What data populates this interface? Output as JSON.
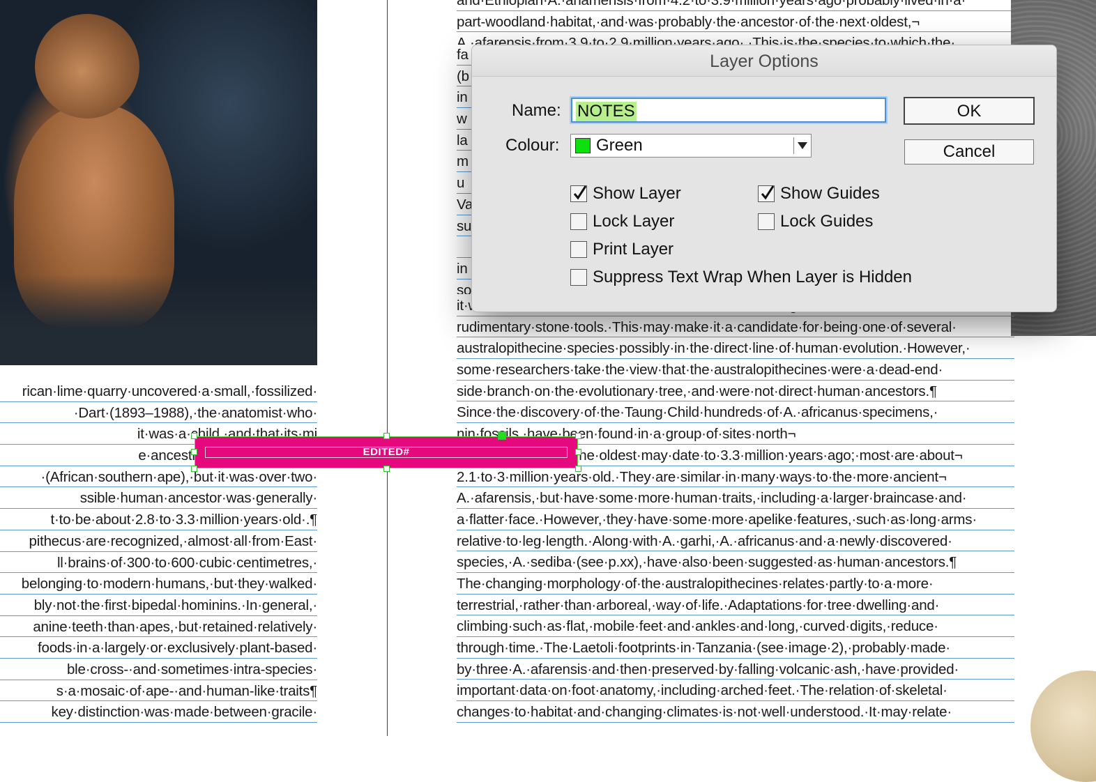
{
  "document": {
    "left_column_lines": [
      "rican·lime·quarry·uncovered·a·small,·fossilized·",
      "·Dart·(1893–1988),·the·anatomist·who·",
      "it·was·a·child,·and·that·its·mi",
      "e·ancestral·to·humans.·He·n",
      "·(African·southern·ape),·but·it·was·over·two·",
      "ssible·human·ancestor·was·generally·",
      "t·to·be·about·2.8·to·3.3·million·years·old·.¶",
      "pithecus·are·recognized,·almost·all·from·East·",
      "ll·brains·of·300·to·600·cubic·centimetres,·",
      "belonging·to·modern·humans,·but·they·walked·",
      "bly·not·the·first·bipedal·hominins.·In·general,·",
      "anine·teeth·than·apes,·but·retained·relatively·",
      "foods·in·a·largely·or·exclusively·plant-based·",
      "ble·cross-·and·sometimes·intra-species·",
      "s·a·mosaic·of·ape-·and·human-like·traits¶",
      "key·distinction·was·made·between·gracile·"
    ],
    "right_top_lines": [
      "and·Ethiopian·A.·anamensis·from·4.2·to·3.9·million·years·ago·probably·lived·in·a·",
      "part-woodland·habitat,·and·was·probably·the·ancestor·of·the·next·oldest,¬",
      "A.·afarensis·from·3.9·to·2.9·million·years·ago·.·This·is·the·species·to·which·the·"
    ],
    "right_partial_lines": [
      "fa",
      "(b",
      "in",
      "w",
      "la",
      "m",
      "u",
      "Va",
      "su",
      "",
      "in",
      "so"
    ],
    "right_bottom_lines": [
      "it·was·found·in·association·with·animal·bones·showing·cut·marks·and·",
      "rudimentary·stone·tools.·This·may·make·it·a·candidate·for·being·one·of·several·",
      "australopithecine·species·possibly·in·the·direct·line·of·human·evolution.·However,·",
      "some·researchers·take·the·view·that·the·australopithecines·were·a·dead-end·",
      "side·branch·on·the·evolutionary·tree,·and·were·not·direct·human·ancestors.¶",
      "  Since·the·discovery·of·the·Taung·Child·hundreds·of·A.·africanus·specimens,·",
      "                        nin·fossils,·have·been·found·in·a·group·of·sites·north¬",
      "of·Johannesburg.·The·oldest·may·date·to·3.3·million·years·ago;·most·are·about¬",
      "2.1·to·3·million·years·old.·They·are·similar·in·many·ways·to·the·more·ancient¬",
      "A.·afarensis,·but·have·some·more·human·traits,·including·a·larger·braincase·and·",
      "a·flatter·face.·However,·they·have·some·more·apelike·features,·such·as·long·arms·",
      "relative·to·leg·length.·Along·with·A.·garhi,·A.·africanus·and·a·newly·discovered·",
      "species,·A.·sediba·(see·p.xx),·have·also·been·suggested·as·human·ancestors.¶",
      "  The·changing·morphology·of·the·australopithecines·relates·partly·to·a·more·",
      "terrestrial,·rather·than·arboreal,·way·of·life.·Adaptations·for·tree·dwelling·and·",
      "climbing·such·as·flat,·mobile·feet·and·ankles·and·long,·curved·digits,·reduce·",
      "through·time.·The·Laetoli·footprints·in·Tanzania·(see·image·2),·probably·made·",
      "by·three·A.·afarensis·and·then·preserved·by·falling·volcanic·ash,·have·provided·",
      "important·data·on·foot·anatomy,·including·arched·feet.·The·relation·of·skeletal·",
      "changes·to·habitat·and·changing·climates·is·not·well·understood.·It·may·relate·"
    ],
    "edited_label": "EDITED#"
  },
  "dialog": {
    "title": "Layer Options",
    "name_label": "Name:",
    "name_value": "NOTES",
    "colour_label": "Colour:",
    "colour_value": "Green",
    "colour_swatch": "#0ee00e",
    "ok_label": "OK",
    "cancel_label": "Cancel",
    "checkboxes": [
      {
        "label": "Show Layer",
        "checked": true
      },
      {
        "label": "Lock Layer",
        "checked": false
      },
      {
        "label": "Print Layer",
        "checked": false
      },
      {
        "label": "Suppress Text Wrap When Layer is Hidden",
        "checked": false
      },
      {
        "label": "Show Guides",
        "checked": true
      },
      {
        "label": "Lock Guides",
        "checked": false
      }
    ]
  },
  "colors": {
    "frame_fill": "#e6097e",
    "link_color": "#e0007a",
    "baseline_grid": "#5b9bd5",
    "focus_ring": "#4a90d9"
  }
}
